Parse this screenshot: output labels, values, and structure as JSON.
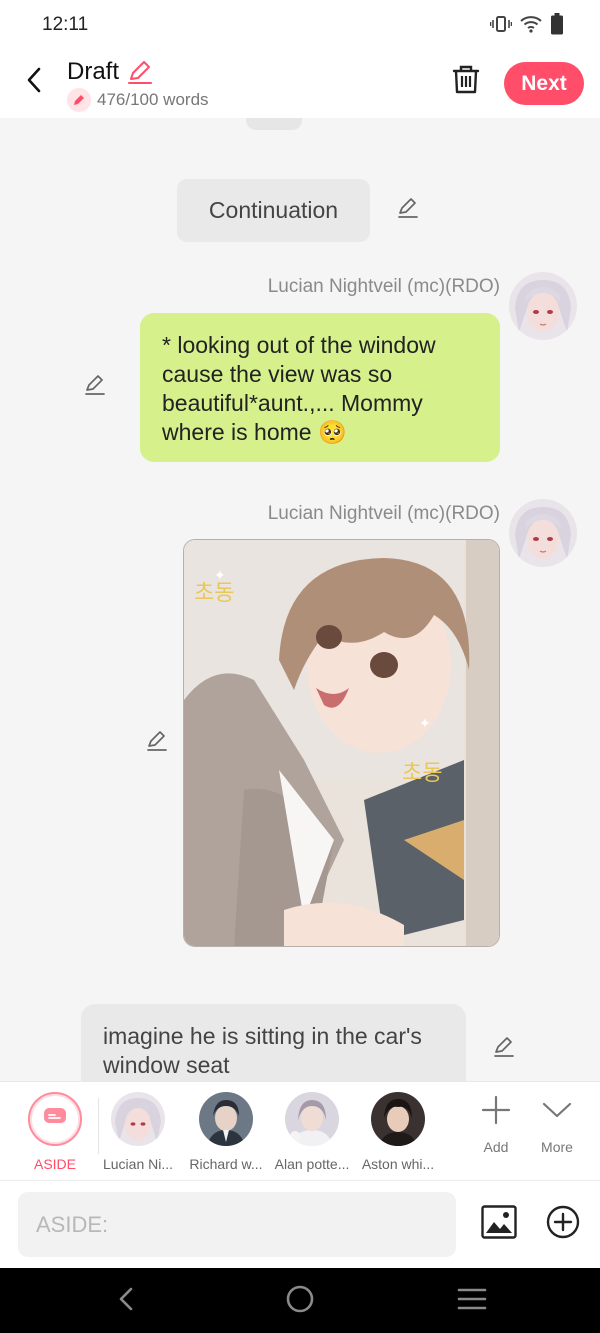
{
  "status": {
    "time": "12:11"
  },
  "header": {
    "title": "Draft",
    "word_count": "476/100 words",
    "next_label": "Next"
  },
  "messages": {
    "continuation": "Continuation",
    "msg1": {
      "sender": "Lucian Nightveil (mc)(RDO)",
      "text": "* looking out of the window cause the view was so beautiful*aunt.,... Mommy where is home 🥺"
    },
    "msg2": {
      "sender": "Lucian Nightveil (mc)(RDO)",
      "image_caption": ""
    },
    "msg3": {
      "text": "imagine he is sitting in the car's window seat"
    }
  },
  "characters": {
    "aside_label": "ASIDE",
    "items": [
      {
        "label": "Lucian Ni..."
      },
      {
        "label": "Richard w..."
      },
      {
        "label": "Alan potte..."
      },
      {
        "label": "Aston whi..."
      }
    ],
    "add_label": "Add",
    "more_label": "More"
  },
  "input": {
    "placeholder": "ASIDE:"
  },
  "colors": {
    "accent": "#ff4d6a",
    "user_bubble": "#d6f08c",
    "narration_bubble": "#e9e9e9"
  },
  "icons": [
    "vibrate-icon",
    "wifi-icon",
    "battery-icon",
    "back-arrow-icon",
    "pencil-icon",
    "trash-icon",
    "chat-bubble-icon",
    "plus-icon",
    "chevron-down-icon",
    "image-icon",
    "circle-plus-icon",
    "nav-back-icon",
    "nav-home-icon",
    "nav-menu-icon"
  ]
}
